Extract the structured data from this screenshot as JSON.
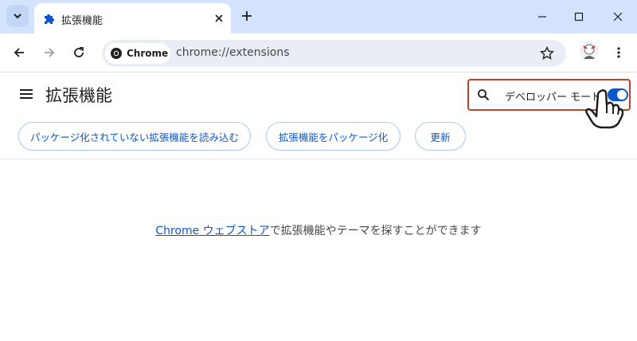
{
  "tab": {
    "title": "拡張機能",
    "close_icon": "close-icon",
    "favicon": "puzzle-icon"
  },
  "toolbar": {
    "chip_label": "Chrome",
    "url": "chrome://extensions",
    "bookmark_icon": "star-icon"
  },
  "header": {
    "title": "拡張機能",
    "dev_mode_label": "デベロッパー モード",
    "dev_mode_on": true
  },
  "actions": {
    "load_unpacked": "パッケージ化されていない拡張機能を読み込む",
    "pack": "拡張機能をパッケージ化",
    "update": "更新"
  },
  "empty_state": {
    "link_text": "Chrome ウェブストア",
    "rest_text": "で拡張機能やテーマを探すことができます"
  },
  "colors": {
    "accent": "#0b57d0",
    "tabstrip": "#d3e3fd",
    "highlight_border": "#b5462a"
  }
}
